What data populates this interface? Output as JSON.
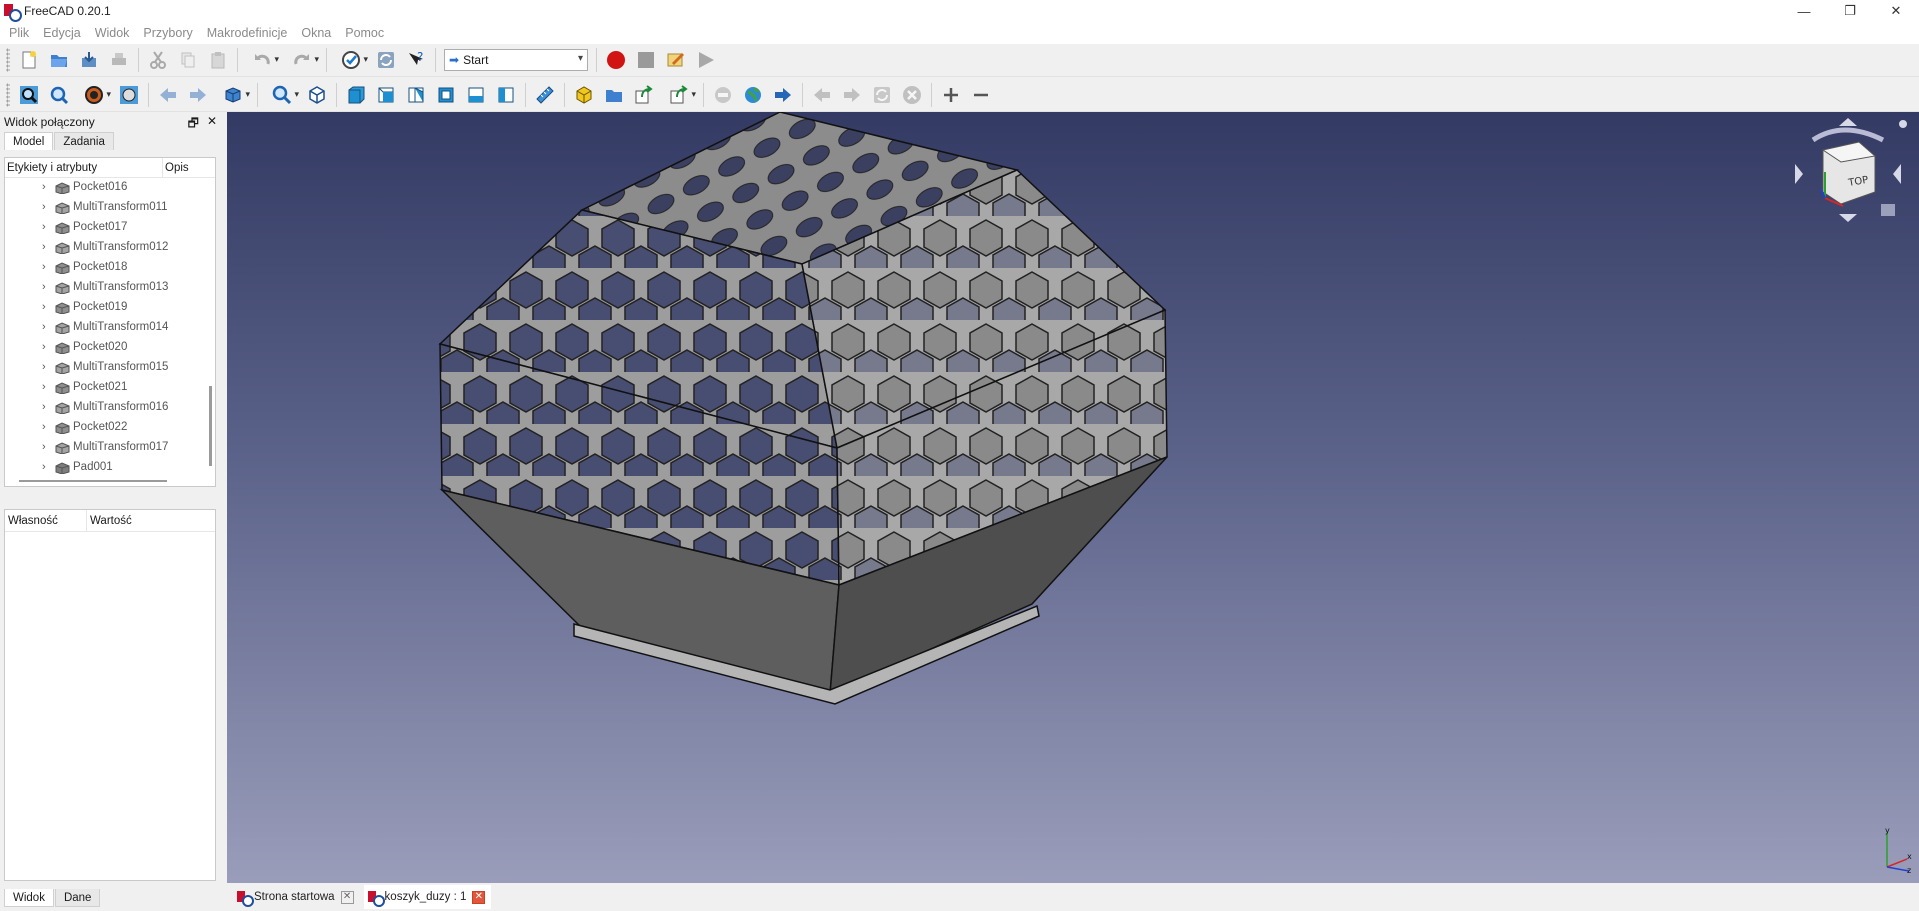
{
  "window": {
    "title": "FreeCAD 0.20.1",
    "minimize": "—",
    "restore": "❐",
    "close": "✕"
  },
  "menu": [
    "Plik",
    "Edycja",
    "Widok",
    "Przybory",
    "Makrodefinicje",
    "Okna",
    "Pomoc"
  ],
  "workbench": {
    "selected": "Start"
  },
  "combo_view": {
    "title": "Widok połączony",
    "float_button": "🗗",
    "close_button": "✕",
    "tabs": [
      "Model",
      "Zadania"
    ],
    "tree_columns": [
      "Etykiety i atrybuty",
      "Opis"
    ],
    "tree_items": [
      {
        "label": "Pocket016",
        "type": "pocket"
      },
      {
        "label": "MultiTransform011",
        "type": "multitransform"
      },
      {
        "label": "Pocket017",
        "type": "pocket"
      },
      {
        "label": "MultiTransform012",
        "type": "multitransform"
      },
      {
        "label": "Pocket018",
        "type": "pocket"
      },
      {
        "label": "MultiTransform013",
        "type": "multitransform"
      },
      {
        "label": "Pocket019",
        "type": "pocket"
      },
      {
        "label": "MultiTransform014",
        "type": "multitransform"
      },
      {
        "label": "Pocket020",
        "type": "pocket"
      },
      {
        "label": "MultiTransform015",
        "type": "multitransform"
      },
      {
        "label": "Pocket021",
        "type": "pocket"
      },
      {
        "label": "MultiTransform016",
        "type": "multitransform"
      },
      {
        "label": "Pocket022",
        "type": "pocket"
      },
      {
        "label": "MultiTransform017",
        "type": "multitransform"
      },
      {
        "label": "Pad001",
        "type": "pad"
      }
    ],
    "property_columns": [
      "Własność",
      "Wartość"
    ],
    "bottom_tabs": [
      "Widok",
      "Dane"
    ]
  },
  "navigation_cube": {
    "face_label": "TOP"
  },
  "axis_labels": {
    "x": "x",
    "y": "y",
    "z": "z"
  },
  "document_tabs": [
    {
      "label": "Strona startowa",
      "active": false
    },
    {
      "label": "koszyk_duzy : 1",
      "active": true
    }
  ]
}
